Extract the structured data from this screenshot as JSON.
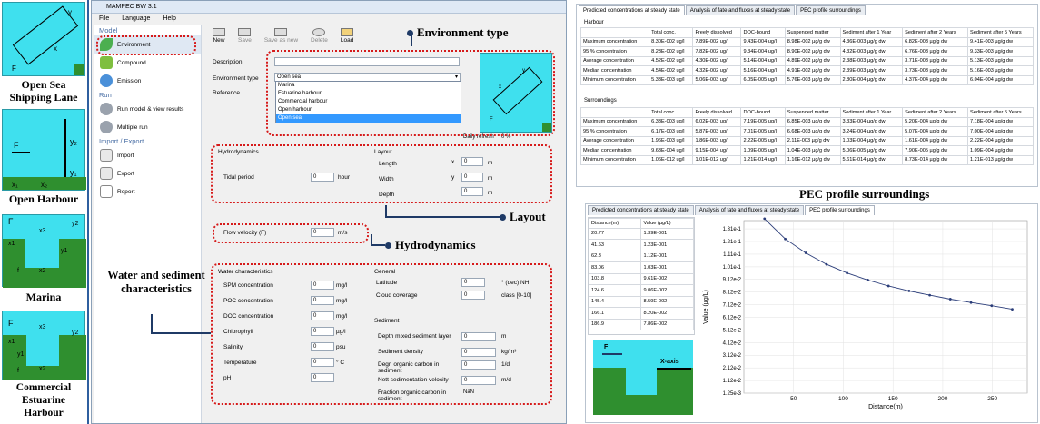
{
  "captions": {
    "open_sea": "Open Sea Shipping Lane",
    "open_harbour": "Open Harbour",
    "marina": "Marina",
    "commercial": "Commercial Estuarine Harbour"
  },
  "thumb_labels": {
    "os_y": "y",
    "os_x": "x",
    "os_f": "F",
    "oh_f": "F",
    "oh_y2": "y₂",
    "oh_y1": "y₁",
    "oh_x1": "x₁",
    "oh_x2": "x₂",
    "ma_f": "F",
    "ma_x3": "x3",
    "ma_y2": "y2",
    "ma_x1": "x1",
    "ma_y1": "y1",
    "ma_x2": "x2",
    "ma_fl": "f",
    "ce_f": "F",
    "ce_x3": "x3",
    "ce_y2": "y2",
    "ce_y1": "y1",
    "ce_x1": "x1",
    "ce_x2": "x2",
    "ce_fl": "f"
  },
  "window": {
    "title": "MAMPEC BW 3.1",
    "menu": [
      "File",
      "Language",
      "Help"
    ]
  },
  "sidebar": {
    "model_header": "Model",
    "model_items": [
      "Environment",
      "Compound",
      "Emission"
    ],
    "run_header": "Run",
    "run_items": [
      "Run model & view results",
      "Multiple run"
    ],
    "io_header": "Import / Export",
    "io_items": [
      "Import",
      "Export",
      "Report"
    ]
  },
  "toolbar": [
    "New",
    "Save",
    "Save as new",
    "Delete",
    "Load"
  ],
  "form": {
    "description_label": "Description",
    "env_type_label": "Environment type",
    "env_type_value": "Open sea",
    "reference_label": "Reference",
    "dropdown_options": [
      "Marina",
      "Estuarine harbour",
      "Commercial harbour",
      "Open harbour",
      "Open sea"
    ],
    "daily_refresh_label": "Daily refresh",
    "daily_refresh_value": "0 %",
    "preview_labels": {
      "x": "x",
      "y": "y",
      "f": "F"
    },
    "hydro_header": "Hydrodynamics",
    "tidal_label": "Tidal period",
    "tidal_value": "0",
    "tidal_unit": "hour",
    "layout_header": "Layout",
    "length_label": "Length",
    "width_label": "Width",
    "depth_label": "Depth",
    "length_axis": "x",
    "width_axis": "y",
    "length_value": "0",
    "width_value": "0",
    "depth_value": "0",
    "m": "m",
    "flow_label": "Flow velocity (F)",
    "flow_value": "0",
    "flow_unit": "m/s",
    "water_header": "Water characteristics",
    "water_rows": [
      {
        "label": "SPM concentration",
        "value": "0",
        "unit": "mg/l"
      },
      {
        "label": "POC concentration",
        "value": "0",
        "unit": "mg/l"
      },
      {
        "label": "DOC concentration",
        "value": "0",
        "unit": "mg/l"
      },
      {
        "label": "Chlorophyll",
        "value": "0",
        "unit": "µg/l"
      },
      {
        "label": "Salinity",
        "value": "0",
        "unit": "psu"
      },
      {
        "label": "Temperature",
        "value": "0",
        "unit": "° C"
      },
      {
        "label": "pH",
        "value": "0",
        "unit": ""
      }
    ],
    "general_header": "General",
    "general_rows": [
      {
        "label": "Latitude",
        "value": "0",
        "unit": "° (dec) NH"
      },
      {
        "label": "Cloud coverage",
        "value": "0",
        "unit": "class [0-10]"
      }
    ],
    "sediment_header": "Sediment",
    "sediment_rows": [
      {
        "label": "Depth mixed sediment layer",
        "value": "0",
        "unit": "m"
      },
      {
        "label": "Sediment density",
        "value": "0",
        "unit": "kg/m³"
      },
      {
        "label": "Degr. organic carbon in sediment",
        "value": "0",
        "unit": "1/d"
      },
      {
        "label": "Nett sedimentation velocity",
        "value": "0",
        "unit": "m/d"
      },
      {
        "label": "Fraction organic carbon in sediment",
        "value": "NaN",
        "unit": ""
      }
    ]
  },
  "callouts": {
    "env_type": "Environment type",
    "layout": "Layout",
    "hydro": "Hydrodynamics",
    "water": "Water and sediment characteristics",
    "pec": "PEC  profile surroundings"
  },
  "results": {
    "tabs": [
      "Predicted concentrations at steady state",
      "Analysis of fate and fluxes at steady state",
      "PEC profile surroundings"
    ],
    "harbour_title": "Harbour",
    "surroundings_title": "Surroundings",
    "columns": [
      "",
      "Total conc.",
      "Freely dissolved",
      "DOC-bound",
      "Suspended matter",
      "Sediment after 1 Year",
      "Sediment after 2 Years",
      "Sediment after 5 Years"
    ],
    "harbour_rows": [
      [
        "Maximum concentration",
        "8.30E-002 ug/l",
        "7.89E-002 ug/l",
        "9.43E-004 ug/l",
        "8.98E-002 µg/g dw",
        "4.36E-003 µg/g dw",
        "6.82E-003 µg/g dw",
        "9.41E-003 µg/g dw"
      ],
      [
        "95 % concentration",
        "8.23E-002 ug/l",
        "7.82E-002 ug/l",
        "9.34E-004 ug/l",
        "8.90E-002 µg/g dw",
        "4.32E-003 µg/g dw",
        "6.76E-003 µg/g dw",
        "9.33E-003 µg/g dw"
      ],
      [
        "Average concentration",
        "4.52E-002 ug/l",
        "4.30E-002 ug/l",
        "5.14E-004 ug/l",
        "4.89E-002 µg/g dw",
        "2.38E-003 µg/g dw",
        "3.71E-003 µg/g dw",
        "5.13E-003 µg/g dw"
      ],
      [
        "Median concentration",
        "4.54E-002 ug/l",
        "4.32E-002 ug/l",
        "5.16E-004 ug/l",
        "4.91E-002 µg/g dw",
        "2.39E-003 µg/g dw",
        "3.73E-003 µg/g dw",
        "5.16E-003 µg/g dw"
      ],
      [
        "Minimum concentration",
        "5.33E-003 ug/l",
        "5.06E-003 ug/l",
        "6.05E-005 ug/l",
        "5.76E-003 µg/g dw",
        "2.80E-004 µg/g dw",
        "4.37E-004 µg/g dw",
        "6.04E-004 µg/g dw"
      ]
    ],
    "surroundings_rows": [
      [
        "Maximum concentration",
        "6.33E-003 ug/l",
        "6.02E-003 ug/l",
        "7.19E-005 ug/l",
        "6.85E-003 µg/g dw",
        "3.33E-004 µg/g dw",
        "5.20E-004 µg/g dw",
        "7.18E-004 µg/g dw"
      ],
      [
        "95 % concentration",
        "6.17E-003 ug/l",
        "5.87E-003 ug/l",
        "7.01E-005 ug/l",
        "6.68E-003 µg/g dw",
        "3.24E-004 µg/g dw",
        "5.07E-004 µg/g dw",
        "7.00E-004 µg/g dw"
      ],
      [
        "Average concentration",
        "1.96E-003 ug/l",
        "1.86E-003 ug/l",
        "2.22E-005 ug/l",
        "2.11E-003 µg/g dw",
        "1.03E-004 µg/g dw",
        "1.61E-004 µg/g dw",
        "2.22E-004 µg/g dw"
      ],
      [
        "Median concentration",
        "9.63E-004 ug/l",
        "9.15E-004 ug/l",
        "1.09E-005 ug/l",
        "1.04E-003 µg/g dw",
        "5.06E-005 µg/g dw",
        "7.90E-005 µg/g dw",
        "1.09E-004 µg/g dw"
      ],
      [
        "Minimum concentration",
        "1.06E-012 ug/l",
        "1.01E-012 ug/l",
        "1.21E-014 ug/l",
        "1.16E-012 µg/g dw",
        "5.61E-014 µg/g dw",
        "8.73E-014 µg/g dw",
        "1.21E-013 µg/g dw"
      ]
    ],
    "pec_columns": [
      "Distance(m)",
      "Value (µg/L)"
    ],
    "pec_rows": [
      [
        "20.77",
        "1.39E-001"
      ],
      [
        "41.63",
        "1.23E-001"
      ],
      [
        "62.3",
        "1.12E-001"
      ],
      [
        "83.06",
        "1.03E-001"
      ],
      [
        "103.8",
        "9.61E-002"
      ],
      [
        "124.6",
        "9.06E-002"
      ],
      [
        "145.4",
        "8.59E-002"
      ],
      [
        "166.1",
        "8.20E-002"
      ],
      [
        "186.9",
        "7.86E-002"
      ]
    ],
    "mini_labels": {
      "f": "F",
      "xaxis": "X-axis"
    }
  },
  "chart_data": {
    "type": "line",
    "x": [
      20.77,
      41.63,
      62.3,
      83.06,
      103.8,
      124.6,
      145.4,
      166.1,
      186.9,
      207.6,
      228.4,
      249.2,
      269.9
    ],
    "y": [
      0.139,
      0.123,
      0.112,
      0.103,
      0.0961,
      0.0906,
      0.0859,
      0.082,
      0.0786,
      0.0755,
      0.0728,
      0.0703,
      0.0675
    ],
    "xlabel": "Distance(m)",
    "ylabel": "Value (µg/L)",
    "xticks": [
      "50",
      "100",
      "150",
      "200",
      "250"
    ],
    "yticks": [
      "1.31e-1",
      "1.21e-1",
      "1.11e-1",
      "1.01e-1",
      "9.12e-2",
      "8.12e-2",
      "7.12e-2",
      "6.12e-2",
      "5.12e-2",
      "4.12e-2",
      "3.12e-2",
      "2.12e-2",
      "1.12e-2",
      "1.25e-3"
    ],
    "xlim": [
      0,
      285
    ],
    "ylim": [
      0.00125,
      0.1375
    ],
    "grid": true,
    "line_color": "#2c3e7a"
  }
}
